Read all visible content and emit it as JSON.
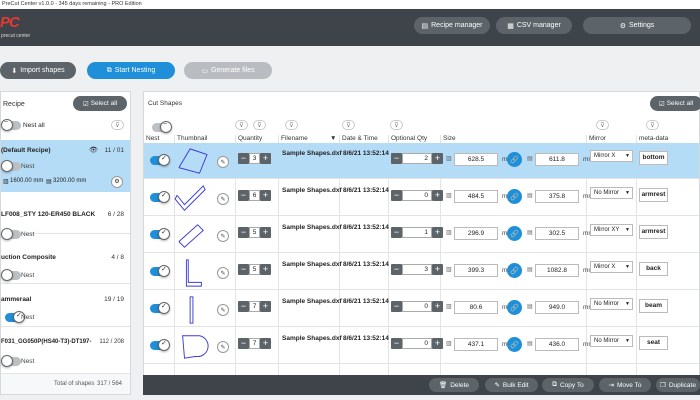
{
  "window": {
    "title": "PreCut Center v1.0.0 - 345 days remaining - PRO Edition"
  },
  "logo": {
    "mark": "PC",
    "subtitle": "precut center"
  },
  "topnav": [
    {
      "label": "Recipe manager",
      "icon": "clipboard-icon"
    },
    {
      "label": "CSV manager",
      "icon": "grid-icon"
    },
    {
      "label": "Settings",
      "icon": "gear-icon"
    }
  ],
  "actions": {
    "import": "Import shapes",
    "start": "Start Nesting",
    "generate": "Generate files"
  },
  "recipes_panel": {
    "title": "Recipe",
    "select_all": "Select all",
    "nest_all": "Nest all",
    "total_label": "Total of shapes",
    "total_value": "317 / 564",
    "items": [
      {
        "name": "(Default Recipe)",
        "count": "11 / 01",
        "nest_label": "Nest",
        "dims": [
          "1600.00 mm",
          "3200.00 mm"
        ]
      },
      {
        "name": "LF008_STY 120-ER450 BLACK",
        "count": "6 / 28",
        "nest_label": "Nest"
      },
      {
        "name": "uction Composite",
        "count": "4 / 8",
        "nest_label": "Nest"
      },
      {
        "name": "ammeraal",
        "count": "19 / 19",
        "nest_label": "Nest"
      },
      {
        "name": "F031_GG050P(HS40-T3)-DT197-",
        "count": "112 / 208",
        "nest_label": "Nest"
      }
    ]
  },
  "shapes_panel": {
    "title": "Cut Shapes",
    "select_all": "Select all",
    "columns": [
      "Nest",
      "Thumbnail",
      "Quantity",
      "Filename",
      "Date & Time",
      "Optional Qty",
      "Size",
      "Mirror",
      "meta-data"
    ],
    "unit": "mm",
    "rows": [
      {
        "qty": "3",
        "file": "Sample Shapes.dxf",
        "date": "8/6/21 13:52:14",
        "opt": "2",
        "w": "628.5",
        "h": "611.8",
        "mirror": "Mirror X",
        "meta": "bottom"
      },
      {
        "qty": "6",
        "file": "Sample Shapes.dxf",
        "date": "8/6/21 13:52:14",
        "opt": "0",
        "w": "484.5",
        "h": "375.8",
        "mirror": "No Mirror",
        "meta": "armrest"
      },
      {
        "qty": "5",
        "file": "Sample Shapes.dxf",
        "date": "8/6/21 13:52:14",
        "opt": "1",
        "w": "296.9",
        "h": "302.5",
        "mirror": "Mirror XY",
        "meta": "armrest"
      },
      {
        "qty": "5",
        "file": "Sample Shapes.dxf",
        "date": "8/6/21 13:52:14",
        "opt": "3",
        "w": "399.3",
        "h": "1082.8",
        "mirror": "Mirror X",
        "meta": "back"
      },
      {
        "qty": "7",
        "file": "Sample Shapes.dxf",
        "date": "8/6/21 13:52:14",
        "opt": "0",
        "w": "80.6",
        "h": "949.0",
        "mirror": "No Mirror",
        "meta": "beam"
      },
      {
        "qty": "7",
        "file": "Sample Shapes.dxf",
        "date": "8/6/21 13:52:14",
        "opt": "0",
        "w": "437.1",
        "h": "436.0",
        "mirror": "No Mirror",
        "meta": "seat"
      }
    ]
  },
  "bottom_actions": [
    "Delete",
    "Bulk Edit",
    "Copy To",
    "Move To",
    "Duplicate"
  ],
  "colors": {
    "topbar": "#3e4449",
    "accent": "#1e8fd8",
    "selected_row": "#b5dcf7",
    "logo": "#e53935"
  }
}
